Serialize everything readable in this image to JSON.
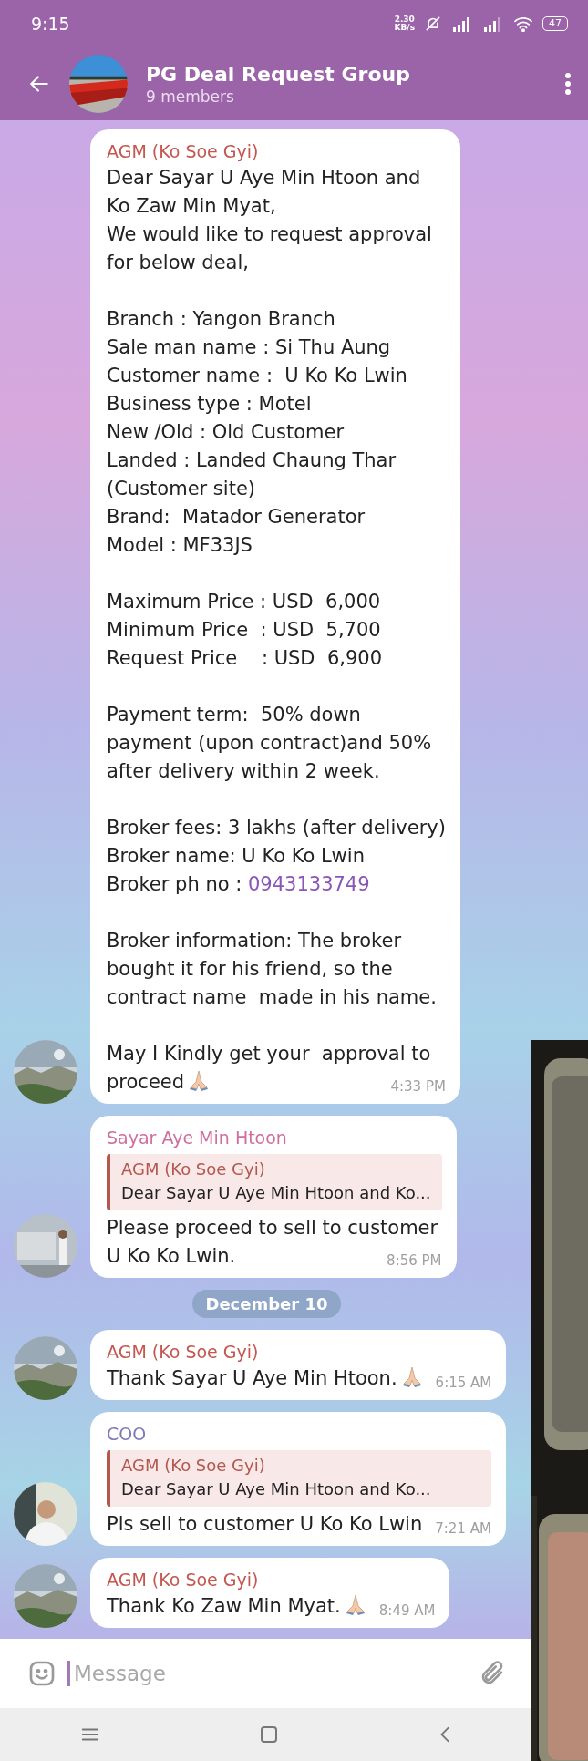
{
  "status_bar": {
    "time": "9:15",
    "net_speed": "2.30",
    "net_unit": "KB/s",
    "battery": "47"
  },
  "header": {
    "title": "PG Deal Request Group",
    "subtitle": "9 members"
  },
  "messages": [
    {
      "sender": "AGM (Ko Soe Gyi)",
      "color": "#c4574f",
      "avatar": true,
      "paragraphs": [
        [
          "Dear Sayar U Aye Min Htoon and",
          "Ko Zaw Min Myat,",
          "We would like to request approval",
          "for below deal,"
        ],
        [
          "Branch : Yangon Branch",
          "Sale man name : Si Thu Aung",
          "Customer name :  U Ko Ko Lwin",
          "Business type : Motel",
          "New /Old : Old Customer",
          "Landed : Landed Chaung Thar",
          "(Customer site)",
          "Brand:  Matador Generator",
          "Model : MF33JS"
        ],
        [
          "Maximum Price : USD  6,000",
          "Minimum Price  : USD  5,700",
          "Request Price    : USD  6,900"
        ],
        [
          "Payment term:  50% down",
          "payment (upon contract)and 50%",
          "after delivery within 2 week."
        ],
        [
          "Broker fees: 3 lakhs (after delivery)",
          "Broker name: U Ko Ko Lwin",
          {
            "text": "Broker ph no : ",
            "link": "0943133749"
          }
        ],
        [
          "Broker information: The broker",
          "bought it for his friend, so the",
          "contract name  made in his name."
        ],
        [
          "May I Kindly get your  approval to",
          "proceed"
        ]
      ],
      "ends_with_emoji": true,
      "time": "4:33 PM"
    },
    {
      "sender": "Sayar Aye Min Htoon",
      "color": "#cf6f9f",
      "avatar": true,
      "reply": {
        "sender": "AGM (Ko Soe Gyi)",
        "text": "Dear Sayar U Aye Min Htoon and Ko..."
      },
      "paragraphs": [
        [
          "Please proceed to sell to customer",
          "U Ko Ko Lwin."
        ]
      ],
      "ends_with_emoji": false,
      "time": "8:56 PM"
    },
    {
      "kind": "date",
      "text": "December 10"
    },
    {
      "sender": "AGM (Ko Soe Gyi)",
      "color": "#c4574f",
      "avatar": true,
      "paragraphs": [
        [
          "Thank Sayar U Aye Min Htoon."
        ]
      ],
      "ends_with_emoji": true,
      "time": "6:15 AM"
    },
    {
      "sender": "COO",
      "color": "#7f78b8",
      "avatar": true,
      "reply": {
        "sender": "AGM (Ko Soe Gyi)",
        "text": "Dear Sayar U Aye Min Htoon and Ko..."
      },
      "paragraphs": [
        [
          "Pls sell to customer U Ko Ko Lwin"
        ]
      ],
      "ends_with_emoji": false,
      "time": "7:21 AM"
    },
    {
      "sender": "AGM (Ko Soe Gyi)",
      "color": "#c4574f",
      "avatar": true,
      "paragraphs": [
        [
          "Thank Ko Zaw Min Myat."
        ]
      ],
      "ends_with_emoji": true,
      "time": "8:49 AM"
    }
  ],
  "composer": {
    "placeholder": "Message"
  }
}
